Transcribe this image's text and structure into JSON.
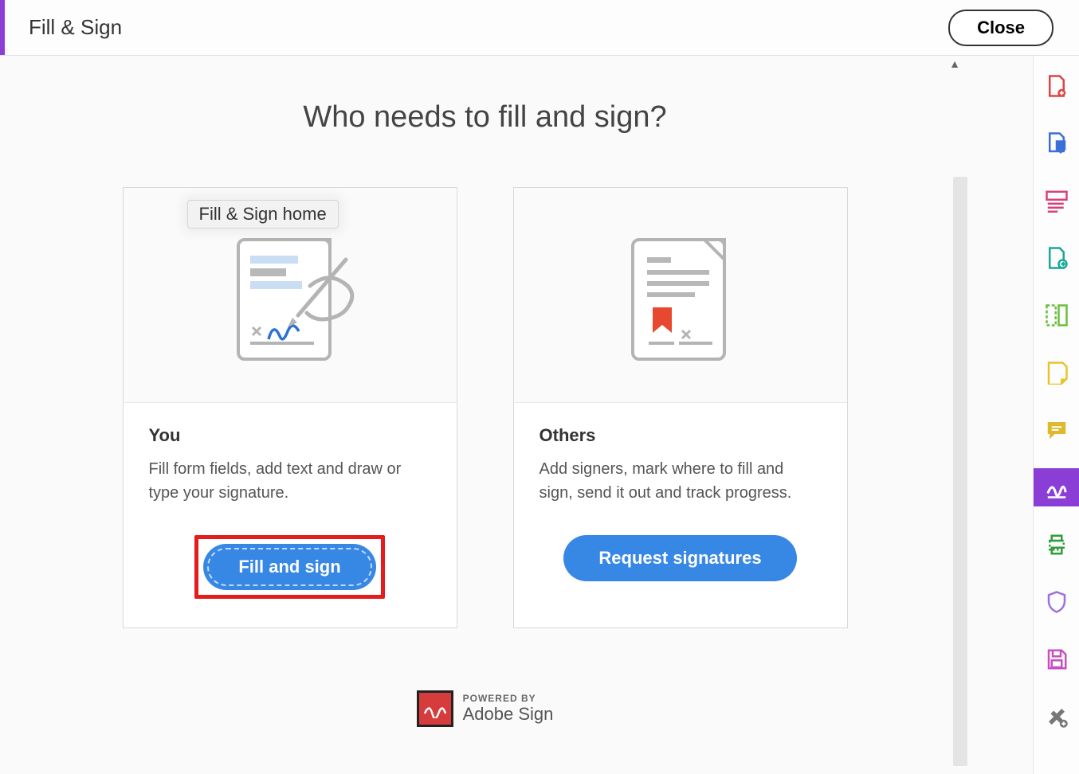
{
  "header": {
    "title": "Fill & Sign",
    "close_label": "Close"
  },
  "heading": "Who needs to fill and sign?",
  "tooltip": "Fill & Sign home",
  "cards": {
    "you": {
      "title": "You",
      "desc": "Fill form fields, add text and draw or type your signature.",
      "button": "Fill and sign"
    },
    "others": {
      "title": "Others",
      "desc": "Add signers, mark where to fill and sign, send it out and track progress.",
      "button": "Request signatures"
    }
  },
  "powered": {
    "small": "POWERED BY",
    "big": "Adobe Sign"
  },
  "sidebar_items": [
    "create-pdf-icon",
    "export-pdf-icon",
    "organize-pages-icon",
    "send-for-review-icon",
    "edit-pdf-icon",
    "comment-icon",
    "fill-sign-icon",
    "print-icon",
    "shield-icon",
    "save-icon",
    "settings-icon"
  ]
}
